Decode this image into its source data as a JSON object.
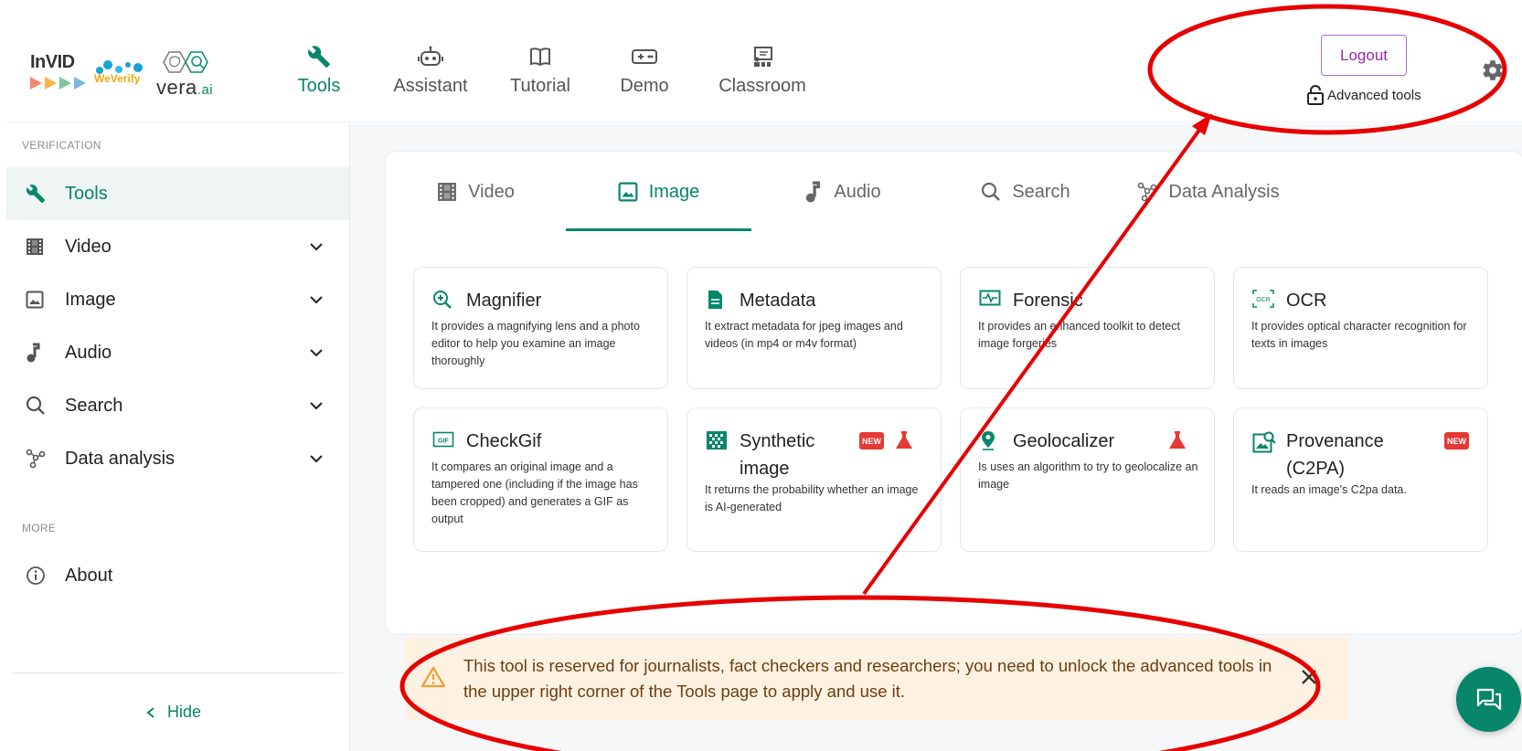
{
  "header": {
    "logos": {
      "invid": "InVID",
      "weverify": "WeVerify",
      "vera": "vera",
      "vera_suffix": ".ai"
    },
    "nav": [
      {
        "label": "Tools",
        "icon": "wrench-icon",
        "active": true
      },
      {
        "label": "Assistant",
        "icon": "robot-icon",
        "active": false
      },
      {
        "label": "Tutorial",
        "icon": "book-icon",
        "active": false
      },
      {
        "label": "Demo",
        "icon": "gamepad-icon",
        "active": false
      },
      {
        "label": "Classroom",
        "icon": "classroom-icon",
        "active": false
      }
    ],
    "logout_label": "Logout",
    "advanced_tools_label": "Advanced tools",
    "settings_icon": "gear-icon"
  },
  "sidebar": {
    "section_verification": "VERIFICATION",
    "items": [
      {
        "label": "Tools",
        "icon": "wrench-icon",
        "active": true,
        "expandable": false
      },
      {
        "label": "Video",
        "icon": "film-icon",
        "active": false,
        "expandable": true
      },
      {
        "label": "Image",
        "icon": "image-icon",
        "active": false,
        "expandable": true
      },
      {
        "label": "Audio",
        "icon": "music-note-icon",
        "active": false,
        "expandable": true
      },
      {
        "label": "Search",
        "icon": "search-icon",
        "active": false,
        "expandable": true
      },
      {
        "label": "Data analysis",
        "icon": "graph-icon",
        "active": false,
        "expandable": true
      }
    ],
    "section_more": "MORE",
    "about_label": "About",
    "hide_label": "Hide"
  },
  "tabs": [
    {
      "label": "Video",
      "icon": "film-icon",
      "active": false
    },
    {
      "label": "Image",
      "icon": "image-icon",
      "active": true
    },
    {
      "label": "Audio",
      "icon": "music-note-icon",
      "active": false
    },
    {
      "label": "Search",
      "icon": "search-icon",
      "active": false
    },
    {
      "label": "Data Analysis",
      "icon": "graph-icon",
      "active": false
    }
  ],
  "cards": [
    {
      "title": "Magnifier",
      "icon": "zoom-icon",
      "desc": "It provides a magnifying lens and a photo editor to help you examine an image thoroughly"
    },
    {
      "title": "Metadata",
      "icon": "document-icon",
      "desc": "It extract metadata for jpeg images and videos (in mp4 or m4v format)"
    },
    {
      "title": "Forensic",
      "icon": "forensic-icon",
      "desc": "It provides an enhanced toolkit to detect image forgeries"
    },
    {
      "title": "OCR",
      "icon": "ocr-icon",
      "desc": "It provides optical character recognition for texts in images"
    },
    {
      "title": "CheckGif",
      "icon": "gif-icon",
      "desc": "It compares an original image and a tampered one (including if the image has been cropped) and generates a GIF as output"
    },
    {
      "title": "Synthetic image",
      "icon": "synthetic-icon",
      "desc": "It returns the probability whether an image is AI-generated",
      "badge_new": "NEW",
      "experimental": true
    },
    {
      "title": "Geolocalizer",
      "icon": "location-pin-icon",
      "desc": "Is uses an algorithm to try to geolocalize an image",
      "experimental": true
    },
    {
      "title": "Provenance (C2PA)",
      "icon": "provenance-icon",
      "desc": "It reads an image's C2pa data.",
      "badge_new": "NEW"
    }
  ],
  "alert": {
    "text": "This tool is reserved for journalists, fact checkers and researchers; you need to unlock the advanced tools in the upper right corner of the Tools page to apply and use it.",
    "icon": "warning-icon",
    "close_icon": "close-icon"
  },
  "chat_icon": "chat-icon",
  "colors": {
    "accent": "#07866a",
    "logout": "#9c27b0",
    "alert_bg": "#fdf1e2",
    "alert_text": "#6b3f10",
    "badge": "#e53935",
    "annotation": "#e60000"
  }
}
